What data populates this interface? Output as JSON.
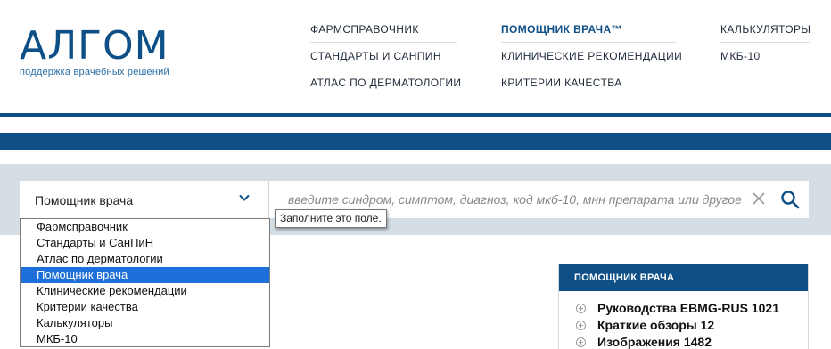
{
  "logo": {
    "wordmark": "АЛГОМ",
    "tagline": "поддержка врачебных решений"
  },
  "nav": {
    "columns": [
      {
        "items": [
          {
            "label": "ФАРМСПРАВОЧНИК"
          },
          {
            "label": "СТАНДАРТЫ И САНПИН"
          },
          {
            "label": "АТЛАС ПО ДЕРМАТОЛОГИИ"
          }
        ]
      },
      {
        "items": [
          {
            "label": "ПОМОЩНИК ВРАЧА™"
          },
          {
            "label": "КЛИНИЧЕСКИЕ РЕКОМЕНДАЦИИ"
          },
          {
            "label": "КРИТЕРИИ КАЧЕСТВА"
          }
        ]
      },
      {
        "items": [
          {
            "label": "КАЛЬКУЛЯТОРЫ"
          },
          {
            "label": "МКБ-10"
          }
        ]
      }
    ]
  },
  "search": {
    "category_selected": "Помощник врача",
    "placeholder": "введите синдром, симптом, диагноз, код мкб-10, мнн препарата или другое",
    "value": "",
    "tooltip": "Заполните это поле.",
    "options": [
      {
        "label": "Фармсправочник"
      },
      {
        "label": "Стандарты и СанПиН"
      },
      {
        "label": "Атлас по дерматологии"
      },
      {
        "label": "Помощник врача"
      },
      {
        "label": "Клинические рекомендации"
      },
      {
        "label": "Критерии качества"
      },
      {
        "label": "Калькуляторы"
      },
      {
        "label": "МКБ-10"
      }
    ],
    "selected_index": 3
  },
  "panel": {
    "title": "ПОМОЩНИК ВРАЧА",
    "items": [
      {
        "label": "Руководства EBMG-RUS 1021"
      },
      {
        "label": "Краткие обзоры 12"
      },
      {
        "label": "Изображения 1482"
      }
    ]
  },
  "colors": {
    "brand": "#0d4f86",
    "band": "#d5dde5",
    "option_selected": "#1e6fd9"
  },
  "icons": [
    "chevron-down-icon",
    "close-icon",
    "search-icon",
    "plus-circle-icon"
  ]
}
